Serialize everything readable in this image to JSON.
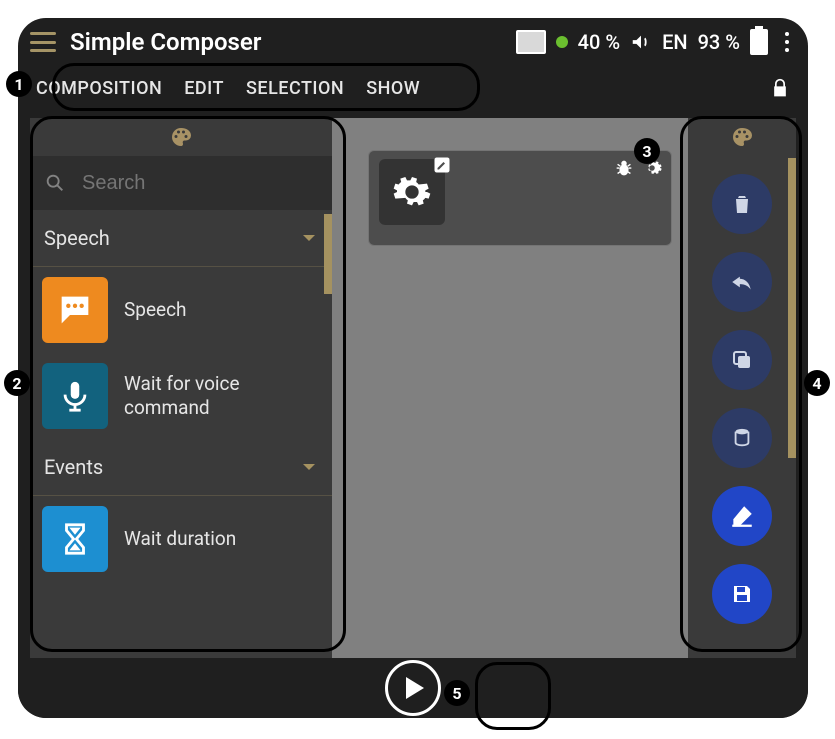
{
  "status": {
    "title": "Simple Composer",
    "brightness": "40 %",
    "language": "EN",
    "battery": "93 %"
  },
  "menu": {
    "items": [
      "COMPOSITION",
      "EDIT",
      "SELECTION",
      "SHOW"
    ]
  },
  "left": {
    "search_placeholder": "Search",
    "categories": [
      {
        "name": "Speech",
        "blocks": [
          {
            "label": "Speech",
            "color": "orange",
            "icon": "speech-bubble"
          },
          {
            "label": "Wait for voice command",
            "color": "teal",
            "icon": "microphone"
          }
        ]
      },
      {
        "name": "Events",
        "blocks": [
          {
            "label": "Wait duration",
            "color": "blue",
            "icon": "hourglass"
          }
        ]
      }
    ]
  },
  "right": {
    "actions": [
      {
        "name": "delete",
        "icon": "trash"
      },
      {
        "name": "undo",
        "icon": "undo"
      },
      {
        "name": "copy",
        "icon": "copy"
      },
      {
        "name": "paste",
        "icon": "cylinder"
      },
      {
        "name": "erase",
        "icon": "eraser",
        "bright": true
      },
      {
        "name": "save",
        "icon": "save",
        "bright": true
      }
    ]
  },
  "canvas": {
    "node": {
      "icon": "gear",
      "edit": true,
      "bug": true,
      "settings": true
    }
  },
  "callouts": [
    "1",
    "2",
    "3",
    "4",
    "5"
  ]
}
